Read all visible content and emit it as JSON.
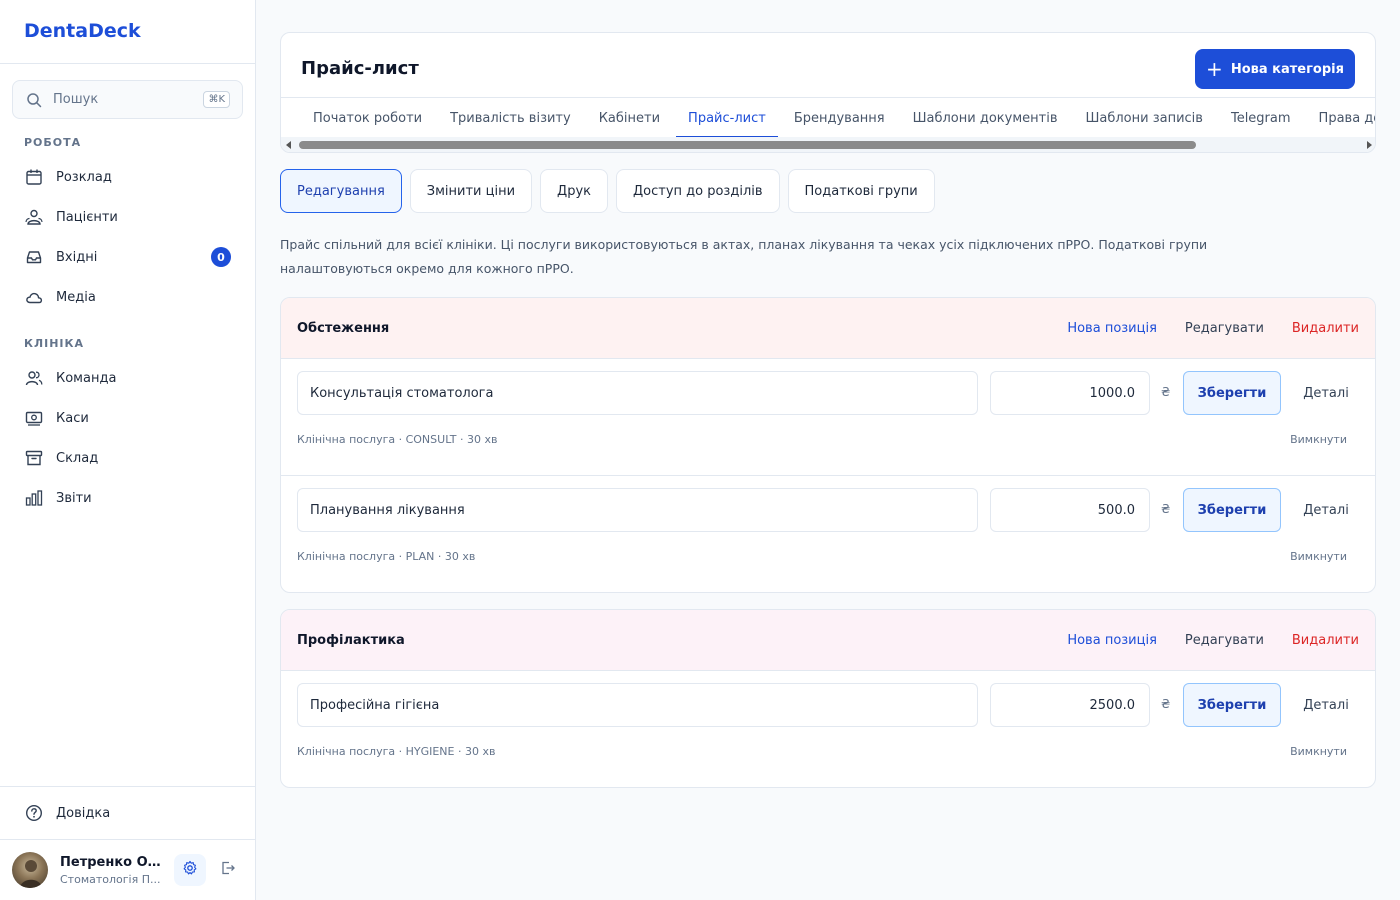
{
  "app": {
    "brand": "DentaDeck"
  },
  "sidebar": {
    "search_placeholder": "Пошук",
    "search_shortcut": "⌘K",
    "sections": {
      "work": "РОБОТА",
      "clinic": "КЛІНІКА"
    },
    "work_items": [
      {
        "label": "Розклад",
        "icon": "calendar-icon"
      },
      {
        "label": "Пацієнти",
        "icon": "users-icon"
      },
      {
        "label": "Вхідні",
        "icon": "inbox-icon",
        "badge": "0"
      },
      {
        "label": "Медіа",
        "icon": "cloud-icon"
      }
    ],
    "clinic_items": [
      {
        "label": "Команда",
        "icon": "team-icon"
      },
      {
        "label": "Каси",
        "icon": "cash-icon"
      },
      {
        "label": "Склад",
        "icon": "archive-icon"
      },
      {
        "label": "Звіти",
        "icon": "bar-chart-icon"
      }
    ],
    "help": {
      "label": "Довідка",
      "icon": "help-icon"
    },
    "user": {
      "name": "Петренко Ол...",
      "subtitle": "Стоматологія П..."
    }
  },
  "header": {
    "title": "Прайс-лист",
    "new_category_label": "Нова категорія",
    "tabs": [
      "Початок роботи",
      "Тривалість візиту",
      "Кабінети",
      "Прайс-лист",
      "Брендування",
      "Шаблони документів",
      "Шаблони записів",
      "Telegram",
      "Права доступу"
    ],
    "active_tab": "Прайс-лист"
  },
  "subtabs": [
    "Редагування",
    "Змінити ціни",
    "Друк",
    "Доступ до розділів",
    "Податкові групи"
  ],
  "active_subtab": "Редагування",
  "description": "Прайс спільний для всієї клініки. Ці послуги використовуються в актах, планах лікування та чеках усіх підключених пРРО. Податкові групи налаштовуються окремо для кожного пРРО.",
  "actions": {
    "new_item": "Нова позиція",
    "edit": "Редагувати",
    "delete": "Видалити",
    "save": "Зберегти",
    "details": "Деталі",
    "disable": "Вимкнути",
    "currency": "₴"
  },
  "groups": [
    {
      "title": "Обстеження",
      "header_color": "#fef2f2",
      "items": [
        {
          "name": "Консультація стоматолога",
          "price": "1000.0",
          "meta": "Клінічна послуга · CONSULT · 30 хв"
        },
        {
          "name": "Планування лікування",
          "price": "500.0",
          "meta": "Клінічна послуга · PLAN · 30 хв"
        }
      ]
    },
    {
      "title": "Профілактика",
      "header_color": "#fdf2f8",
      "items": [
        {
          "name": "Професійна гігієна",
          "price": "2500.0",
          "meta": "Клінічна послуга · HYGIENE · 30 хв"
        }
      ]
    }
  ]
}
